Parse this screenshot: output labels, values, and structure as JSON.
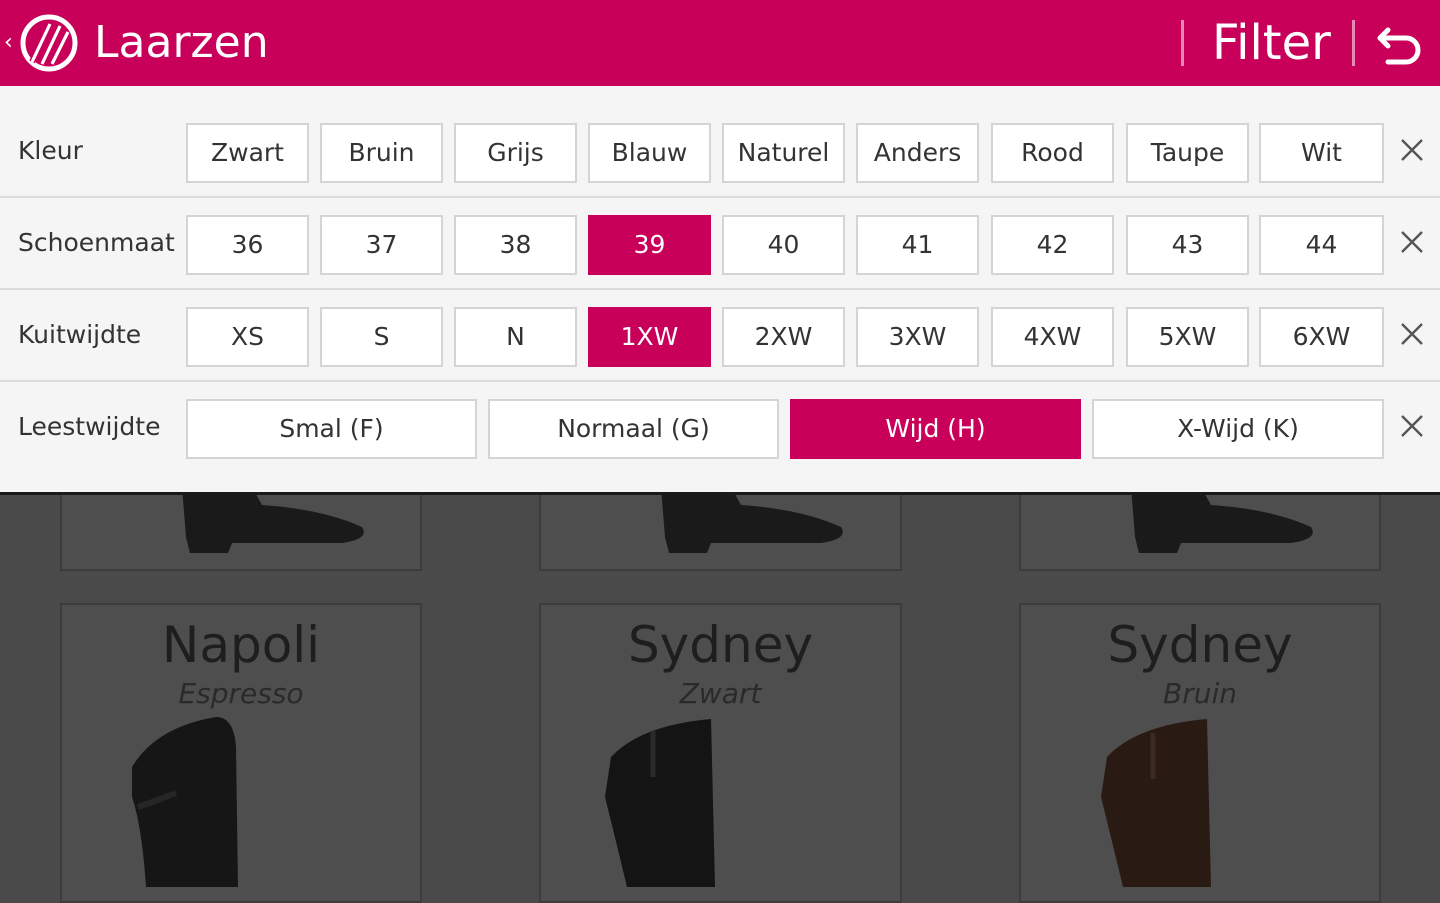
{
  "header": {
    "title": "Laarzen",
    "filter_label": "Filter",
    "brand_color": "#c8005a",
    "icons": {
      "up": "chevron-left-icon",
      "logo": "brand-logo",
      "back": "undo-arrow-icon"
    }
  },
  "filters": [
    {
      "label": "Kleur",
      "options": [
        "Zwart",
        "Bruin",
        "Grijs",
        "Blauw",
        "Naturel",
        "Anders",
        "Rood",
        "Taupe",
        "Wit"
      ],
      "selected": []
    },
    {
      "label": "Schoenmaat",
      "options": [
        "36",
        "37",
        "38",
        "39",
        "40",
        "41",
        "42",
        "43",
        "44"
      ],
      "selected": [
        "39"
      ]
    },
    {
      "label": "Kuitwijdte",
      "options": [
        "XS",
        "S",
        "N",
        "1XW",
        "2XW",
        "3XW",
        "4XW",
        "5XW",
        "6XW"
      ],
      "selected": [
        "1XW"
      ]
    },
    {
      "label": "Leestwijdte",
      "options": [
        "Smal (F)",
        "Normaal (G)",
        "Wijd (H)",
        "X-Wijd (K)"
      ],
      "selected": [
        "Wijd (H)"
      ]
    }
  ],
  "products": [
    {
      "name": "Napoli",
      "color": "Espresso"
    },
    {
      "name": "Sydney",
      "color": "Zwart"
    },
    {
      "name": "Sydney",
      "color": "Bruin"
    }
  ]
}
